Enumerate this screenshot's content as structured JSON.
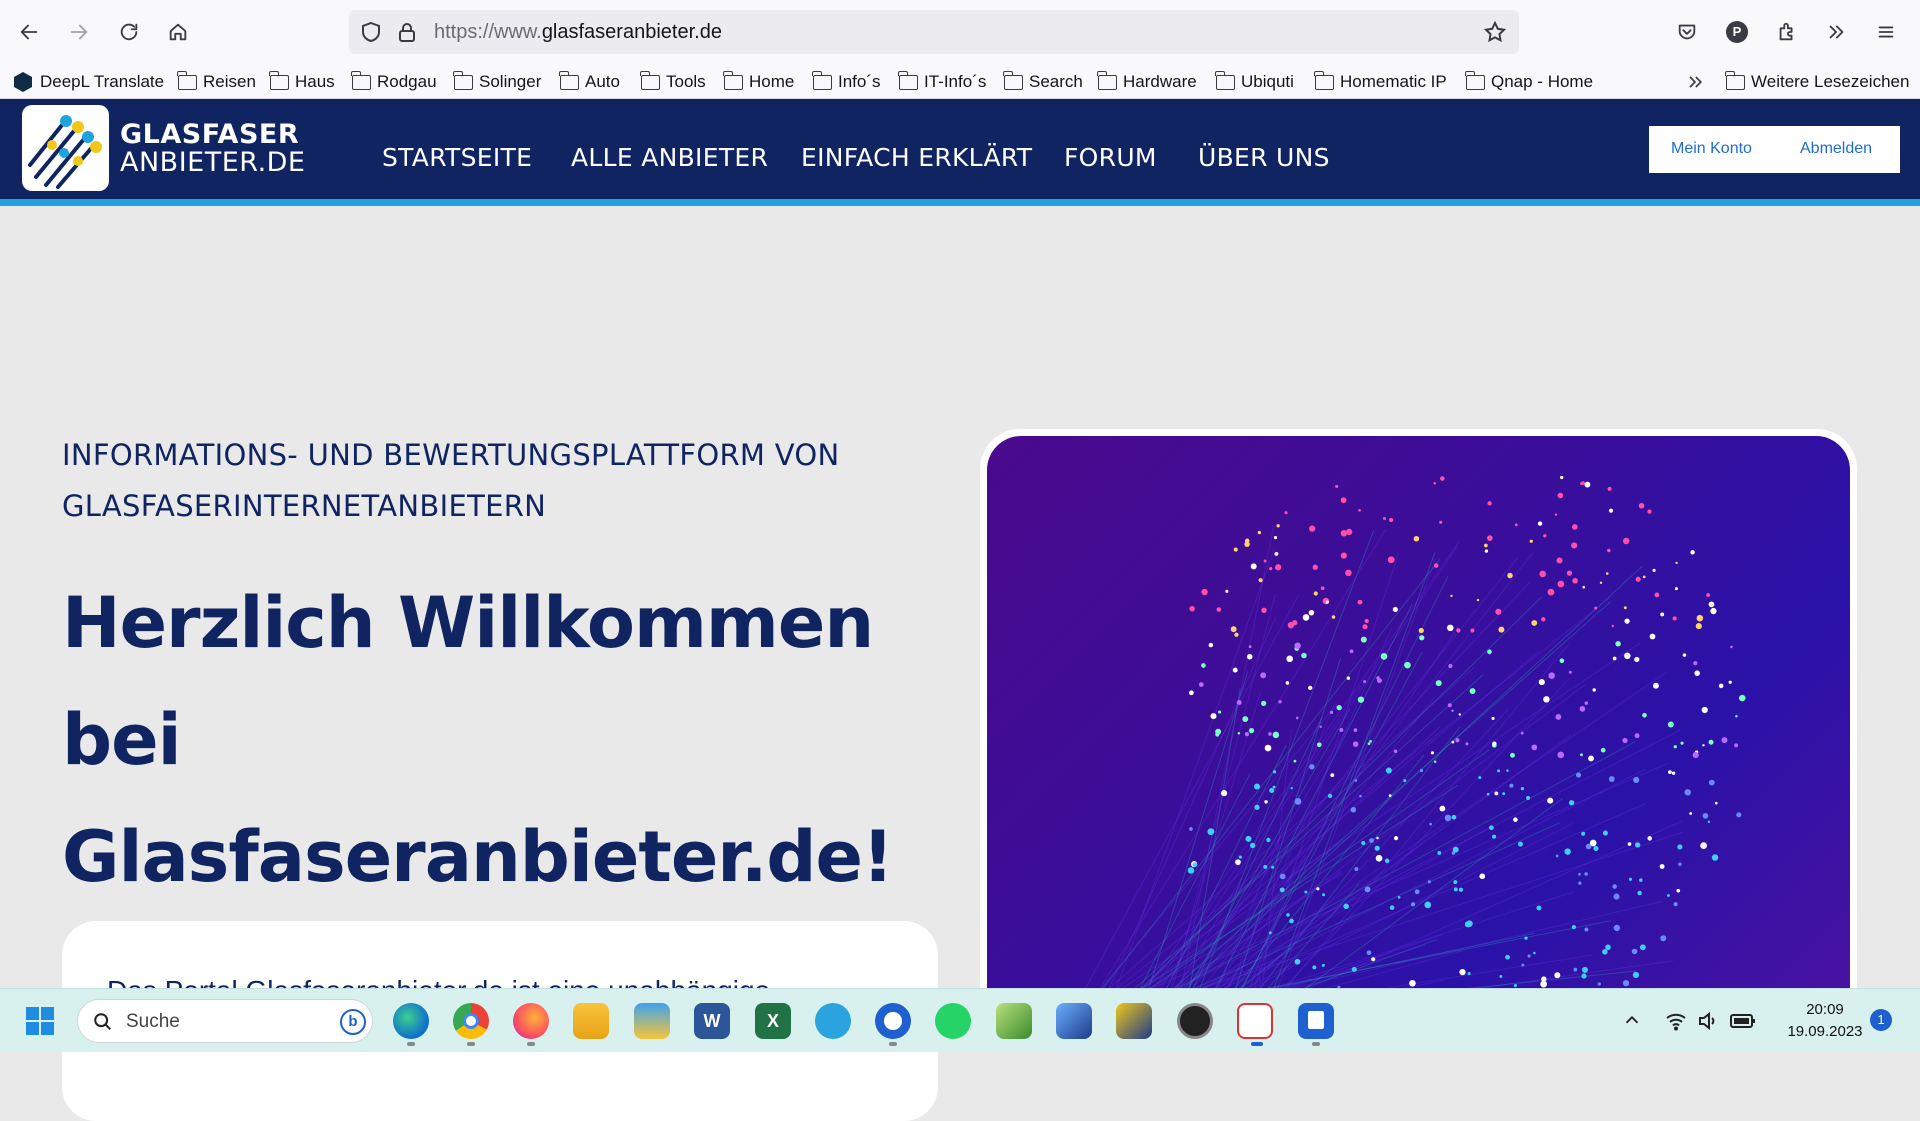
{
  "browser": {
    "url_prefix": "https://www.",
    "url_domain": "glasfaseranbieter.de",
    "profile_initial": "P"
  },
  "bookmarks": {
    "items": [
      "DeepL Translate",
      "Reisen",
      "Haus",
      "Rodgau",
      "Solinger",
      "Auto",
      "Tools",
      "Home",
      "Info´s",
      "IT-Info´s",
      "Search",
      "Hardware",
      "Ubiquti",
      "Homematic IP",
      "Qnap - Home"
    ],
    "more": "Weitere Lesezeichen"
  },
  "site": {
    "logo_line1": "GLASFASER",
    "logo_line2": "ANBIETER.DE",
    "nav": [
      "STARTSEITE",
      "ALLE ANBIETER",
      "EINFACH ERKLÄRT",
      "FORUM",
      "ÜBER UNS"
    ],
    "account": "Mein Konto",
    "logout": "Abmelden"
  },
  "hero": {
    "subtitle_line1": "INFORMATIONS- UND BEWERTUNGSPLATTFORM VON",
    "subtitle_line2": "GLASFASERINTERNETANBIETERN",
    "title_line1": "Herzlich Willkommen",
    "title_line2": "bei",
    "title_line3": "Glasfaseranbieter.de!",
    "card_text": "Das Portal Glasfaseranbieter.de ist eine unabhängige"
  },
  "taskbar": {
    "search_placeholder": "Suche",
    "time": "20:09",
    "date": "19.09.2023",
    "notifications": "1"
  },
  "colors": {
    "navy": "#0f2461",
    "accent_blue": "#1ea3df",
    "link_blue": "#1f6dd1"
  }
}
